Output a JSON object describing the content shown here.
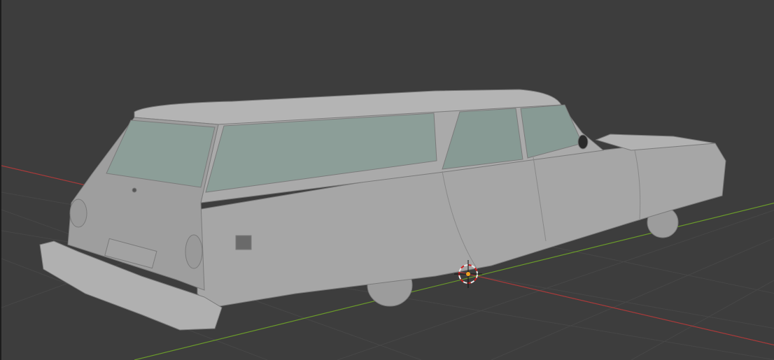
{
  "viewport": {
    "name": "3D Viewport",
    "background_color": "#3d3d3d",
    "grid_color": "#4a4a4a",
    "x_axis_color": "#a83a3a",
    "y_axis_color": "#6a9a2a"
  },
  "scene": {
    "object": "station-wagon-car-model",
    "body_color": "#a9a9a9",
    "glass_color": "#8c9e98",
    "cursor_icon": "3d-cursor-icon",
    "origin_color": "#f0a020"
  }
}
